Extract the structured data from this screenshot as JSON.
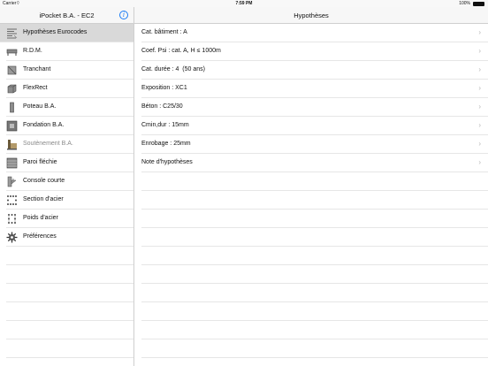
{
  "status_bar": {
    "carrier": "Carrier",
    "time": "7:59 PM",
    "battery": "100%"
  },
  "sidebar": {
    "title": "iPocket B.A. - EC2",
    "items": [
      {
        "label": "Hypothèses Eurocodes",
        "icon": "hypotheses-icon",
        "selected": true,
        "enabled": true
      },
      {
        "label": "R.D.M.",
        "icon": "rdm-icon",
        "selected": false,
        "enabled": true
      },
      {
        "label": "Tranchant",
        "icon": "shear-icon",
        "selected": false,
        "enabled": true
      },
      {
        "label": "FlexRect",
        "icon": "flexrect-icon",
        "selected": false,
        "enabled": true
      },
      {
        "label": "Poteau B.A.",
        "icon": "column-icon",
        "selected": false,
        "enabled": true
      },
      {
        "label": "Fondation B.A.",
        "icon": "foundation-icon",
        "selected": false,
        "enabled": true
      },
      {
        "label": "Soutènement B.A.",
        "icon": "retaining-wall-icon",
        "selected": false,
        "enabled": false
      },
      {
        "label": "Paroi fléchie",
        "icon": "bent-wall-icon",
        "selected": false,
        "enabled": true
      },
      {
        "label": "Console courte",
        "icon": "short-console-icon",
        "selected": false,
        "enabled": true
      },
      {
        "label": "Section d'acier",
        "icon": "steel-section-icon",
        "selected": false,
        "enabled": true
      },
      {
        "label": "Poids d'acier",
        "icon": "steel-weight-icon",
        "selected": false,
        "enabled": true
      },
      {
        "label": "Préférences",
        "icon": "gear-icon",
        "selected": false,
        "enabled": true
      }
    ]
  },
  "detail": {
    "title": "Hypothèses",
    "rows": [
      {
        "label": "Cat. bâtiment : A"
      },
      {
        "label": "Coef. Psi : cat. A, H ≤ 1000m"
      },
      {
        "label": "Cat. durée : 4  (50 ans)"
      },
      {
        "label": "Exposition : XC1"
      },
      {
        "label": "Béton : C25/30"
      },
      {
        "label": "Cmin,dur : 15mm"
      },
      {
        "label": "Enrobage : 25mm"
      },
      {
        "label": "Note d'hypothèses"
      }
    ]
  },
  "colors": {
    "accent": "#1a7cf5",
    "selected_row": "#d9d9d9",
    "separator": "#e6e6e6",
    "disabled_text": "#8a8a8a"
  }
}
